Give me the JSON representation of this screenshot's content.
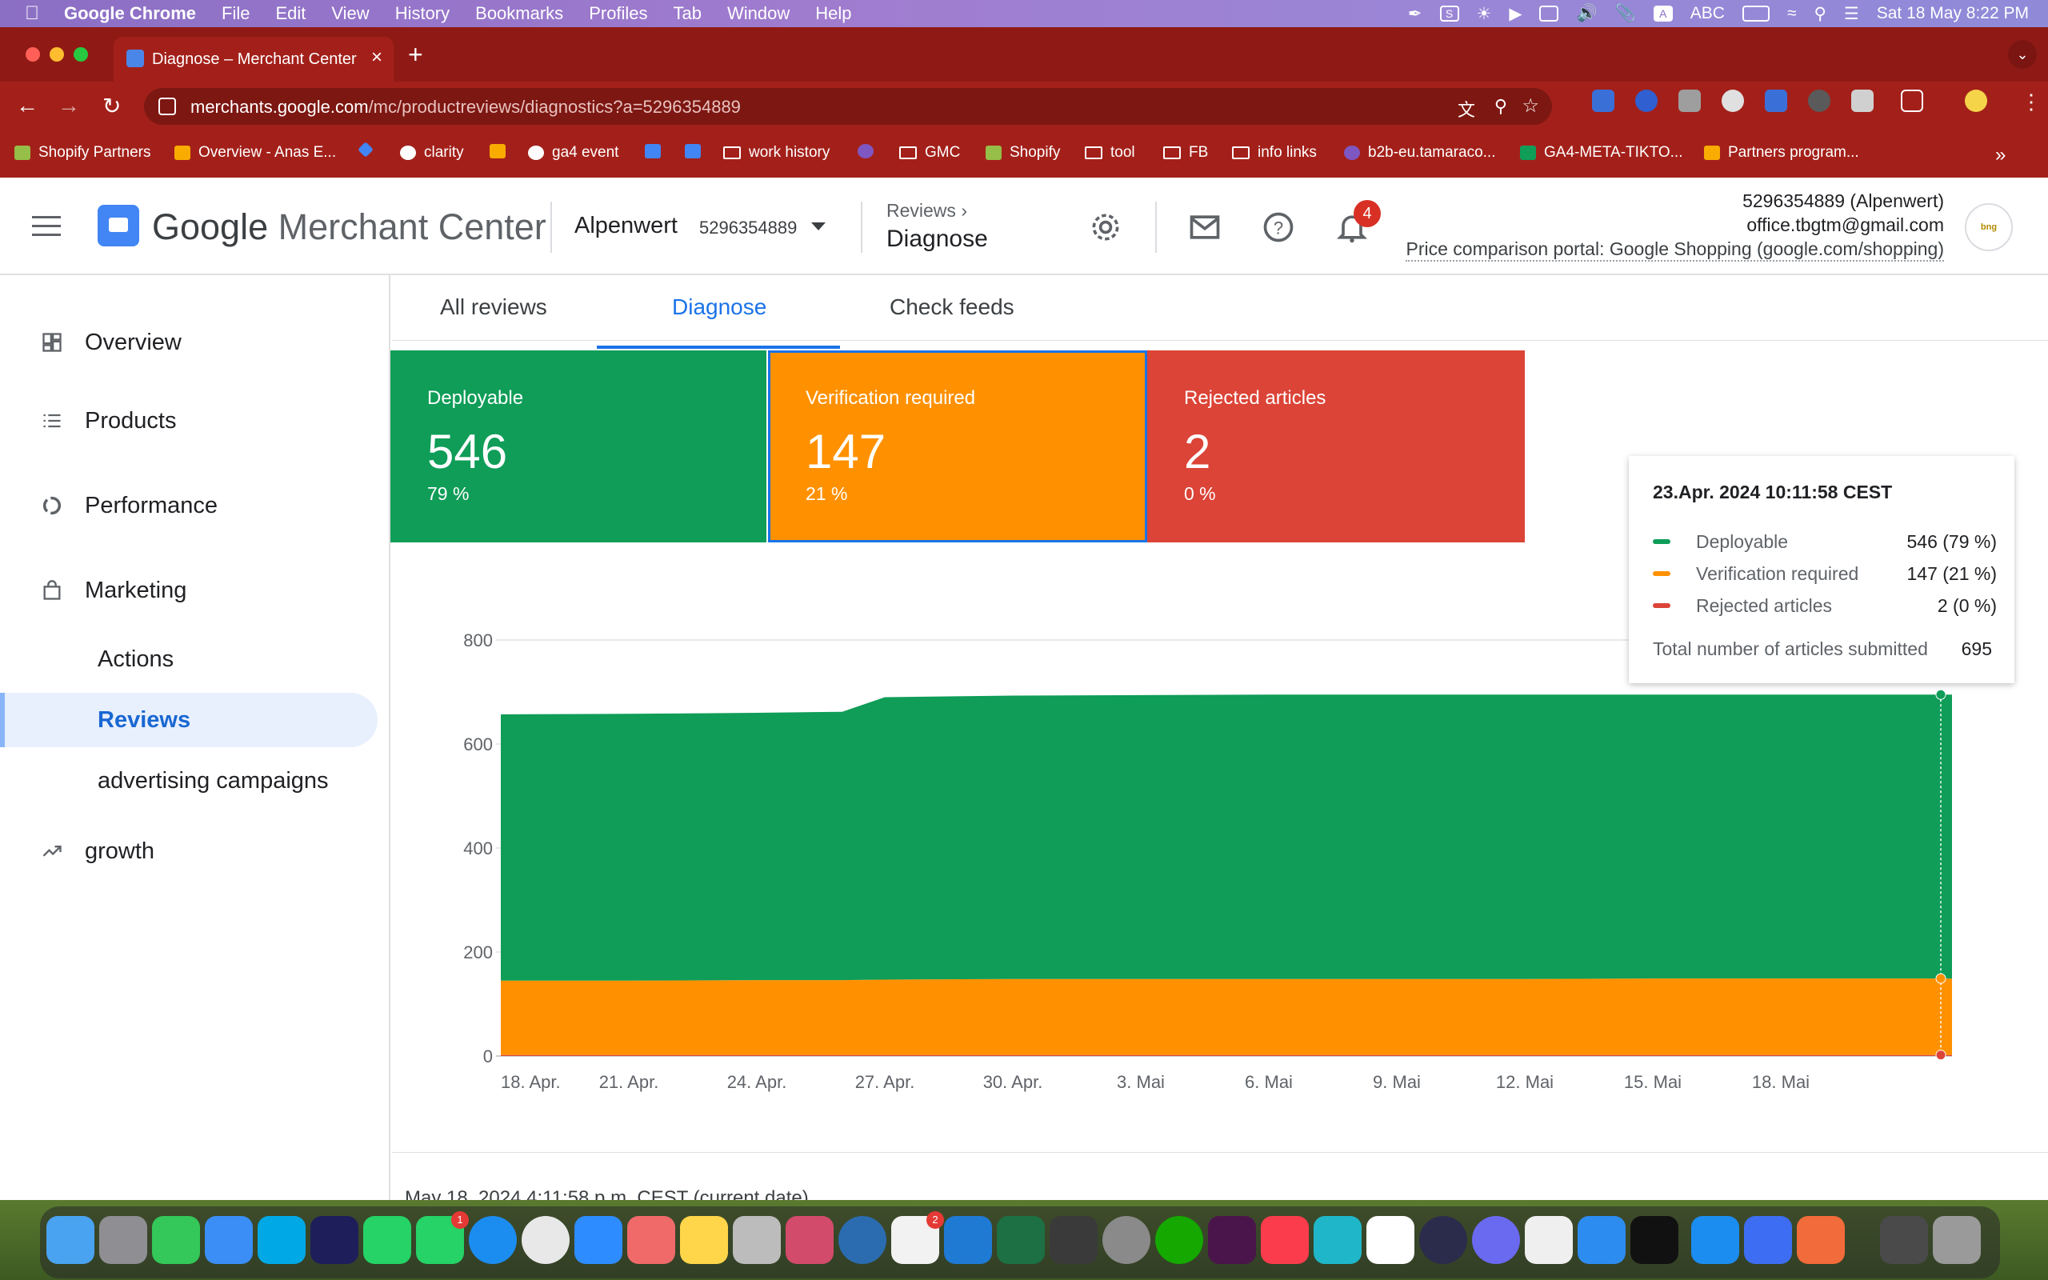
{
  "menubar": {
    "app": "Google Chrome",
    "items": [
      "File",
      "Edit",
      "View",
      "History",
      "Bookmarks",
      "Profiles",
      "Tab",
      "Window",
      "Help"
    ],
    "datetime": "Sat 18 May  8:22 PM",
    "input_source": "ABC"
  },
  "browser": {
    "tab_title": "Diagnose – Merchant Center",
    "url_host": "merchants.google.com",
    "url_path": "/mc/productreviews/diagnostics?a=5296354889",
    "bookmarks": [
      "Shopify Partners",
      "Overview - Anas E...",
      "clarity",
      "ga4 event",
      "work history",
      "GMC",
      "Shopify",
      "tool",
      "FB",
      "info links",
      "b2b-eu.tamaraco...",
      "GA4-META-TIKTO...",
      "Partners program..."
    ]
  },
  "header": {
    "product_name_prefix": "Google",
    "product_name": "Merchant Center",
    "account_name": "Alpenwert",
    "account_id": "5296354889",
    "breadcrumb_parent": "Reviews",
    "breadcrumb_current": "Diagnose",
    "notification_count": "4",
    "account_line1": "5296354889 (Alpenwert)",
    "account_line2": "office.tbgtm@gmail.com",
    "account_line3": "Price comparison portal: Google Shopping (google.com/shopping)"
  },
  "sidebar": {
    "items": [
      {
        "label": "Overview"
      },
      {
        "label": "Products"
      },
      {
        "label": "Performance"
      },
      {
        "label": "Marketing"
      },
      {
        "label": "Actions"
      },
      {
        "label": "Reviews"
      },
      {
        "label": "advertising campaigns"
      },
      {
        "label": "growth"
      }
    ]
  },
  "tabs": [
    "All reviews",
    "Diagnose",
    "Check feeds"
  ],
  "cards": [
    {
      "title": "Deployable",
      "value": "546",
      "percent": "79 %",
      "color": "#0f9d58"
    },
    {
      "title": "Verification required",
      "value": "147",
      "percent": "21 %",
      "color": "#ff9100"
    },
    {
      "title": "Rejected articles",
      "value": "2",
      "percent": "0 %",
      "color": "#db4437"
    }
  ],
  "tooltip": {
    "title": "23.Apr. 2024 10:11:58 CEST",
    "rows": [
      {
        "label": "Deployable",
        "value": "546 (79 %)",
        "color": "#0f9d58"
      },
      {
        "label": "Verification required",
        "value": "147 (21 %)",
        "color": "#ff9100"
      },
      {
        "label": "Rejected articles",
        "value": "2 (0 %)",
        "color": "#db4437"
      }
    ],
    "total_label": "Total number of articles submitted",
    "total_value": "695"
  },
  "chart_data": {
    "type": "area",
    "stacked": true,
    "ylim": [
      0,
      800
    ],
    "yticks": [
      0,
      200,
      400,
      600,
      800
    ],
    "xticks": [
      "18. Apr.",
      "21. Apr.",
      "24. Apr.",
      "27. Apr.",
      "30. Apr.",
      "3. Mai",
      "6. Mai",
      "9. Mai",
      "12. Mai",
      "15. Mai",
      "18. Mai"
    ],
    "x": [
      "18. Apr.",
      "21. Apr.",
      "24. Apr.",
      "26. Apr.",
      "27. Apr.",
      "30. Apr.",
      "3. Mai",
      "6. Mai",
      "9. Mai",
      "12. Mai",
      "15. Mai",
      "18. Mai"
    ],
    "series": [
      {
        "name": "Rejected articles",
        "color": "#db4437",
        "values": [
          2,
          2,
          2,
          2,
          2,
          2,
          2,
          2,
          2,
          2,
          2,
          2
        ]
      },
      {
        "name": "Verification required",
        "color": "#ff9100",
        "values": [
          143,
          143,
          144,
          144,
          145,
          146,
          146,
          146,
          146,
          146,
          147,
          147
        ]
      },
      {
        "name": "Deployable",
        "color": "#0f9d58",
        "values": [
          512,
          513,
          514,
          516,
          543,
          545,
          546,
          547,
          547,
          547,
          546,
          546
        ]
      }
    ],
    "grid": true
  },
  "footer_text": "May 18, 2024 4:11:58 p.m. CEST (current date)"
}
